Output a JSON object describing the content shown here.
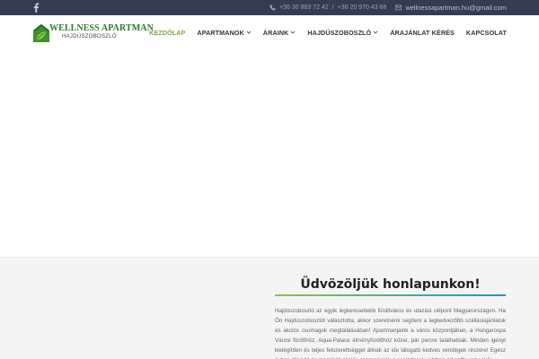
{
  "topbar": {
    "facebook_icon": "facebook-icon",
    "phone_icon": "phone-icon",
    "phone_1": "+36 30 883 72 42",
    "phone_separator": "/",
    "phone_2": "+36 20 970 43 68",
    "mail_icon": "envelope-icon",
    "email": "wellnessapartman.hu@gmail.com"
  },
  "logo": {
    "icon": "house-leaf-icon",
    "title": "WELLNESS APARTMAN",
    "subtitle": "HAJDÚSZOBOSZLÓ"
  },
  "nav": {
    "items": [
      {
        "label": "KEZDŐLAP",
        "active": true,
        "dropdown": false
      },
      {
        "label": "APARTMANOK",
        "active": false,
        "dropdown": true
      },
      {
        "label": "ÁRAINK",
        "active": false,
        "dropdown": true
      },
      {
        "label": "HAJDÚSZOBOSZLÓ",
        "active": false,
        "dropdown": true
      },
      {
        "label": "ÁRAJÁNLAT KÉRÉS",
        "active": false,
        "dropdown": false
      },
      {
        "label": "KAPCSOLAT",
        "active": false,
        "dropdown": false
      }
    ]
  },
  "welcome": {
    "title": "Üdvözöljük honlapunkon!",
    "text": "Hajdúszoboszló az egyik legkeresettebb fürdőváros és utazási célpont Magyarországon. Ha Ön Hajdúszoboszlót választotta, akkor szeretnénk segíteni a legkedvezőbb szálláslajánlatok és akciós csomagok megtalálásában! Apartmanjaink a város központjában, a Hungarospa Városi fürdőhöz, Aqua-Palace élményfürdőhöz közel, pár percre találhatóak. Minden igényt kielégítően és teljes felszereltséggel állnak az ide látogató kedves vendégek részére! Egész évben állandó és megújuló akciós csomagjaink a családosok, párban érkezők vagy akár"
  },
  "colors": {
    "topbar_bg": "#333d52",
    "accent_green": "#7aa93c",
    "logo_green": "#2e7a2a",
    "rule_blue": "#2196c4"
  }
}
